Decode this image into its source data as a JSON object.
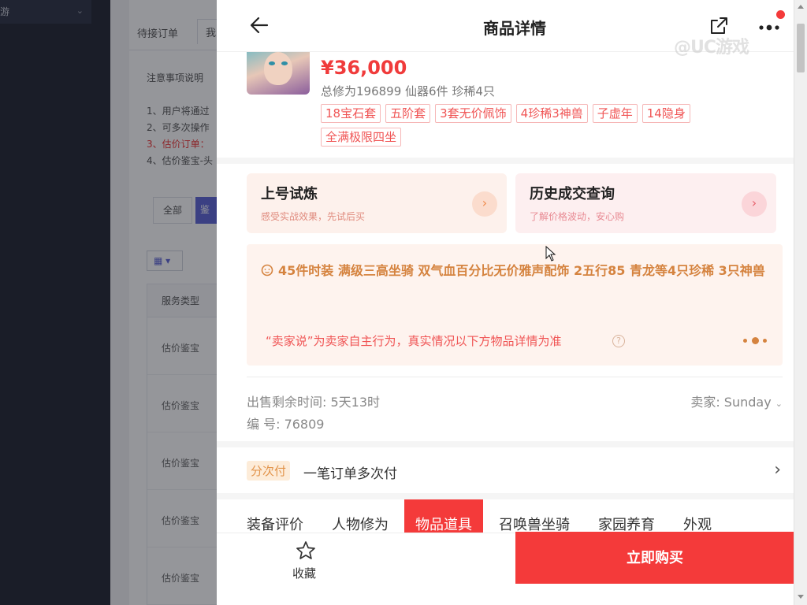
{
  "background_app": {
    "sidebar_menu_label": "游",
    "tabs": [
      "待接订单",
      "我"
    ],
    "notice_title": "注意事项说明",
    "notice_lines": [
      "1、用户将通过",
      "2、可多次操作",
      "3、估价订单：",
      "4、估价鉴宝-头"
    ],
    "filter_all": "全部",
    "filter_active": "鉴",
    "grid_button": "▦ ▾",
    "table_header": "服务类型",
    "table_rows": [
      "估价鉴宝",
      "估价鉴宝",
      "估价鉴宝",
      "估价鉴宝",
      "估价鉴宝"
    ]
  },
  "topbar": {
    "title": "商品详情",
    "watermark": "@UC游戏"
  },
  "product": {
    "price": "¥36,000",
    "stats": "总修为196899  仙器6件  珍稀4只",
    "tags": [
      "18宝石套",
      "五阶套",
      "3套无价佩饰",
      "4珍稀3神兽",
      "子虚年",
      "14隐身",
      "全满极限四坐"
    ]
  },
  "promos": [
    {
      "title": "上号试炼",
      "subtitle": "感受实战效果，先试后买"
    },
    {
      "title": "历史成交查询",
      "subtitle": "了解价格波动，安心购"
    }
  ],
  "seller_says": {
    "text": "45件时装 满级三高坐骑 双气血百分比无价雅声配饰 2五行85 青龙等4只珍稀 3只神兽",
    "disclaimer": "“卖家说”为卖家自主行为，真实情况以下方物品详情为准",
    "help_icon": "?"
  },
  "meta": {
    "remaining_time": "出售剩余时间: 5天13时",
    "serial": "编  号: 76809",
    "seller": "卖家: Sunday"
  },
  "installment": {
    "badge": "分次付",
    "text": "一笔订单多次付"
  },
  "detail_tabs": [
    "装备评价",
    "人物修为",
    "物品道具",
    "召唤兽坐骑",
    "家园养育",
    "外观"
  ],
  "active_tab_index": 2,
  "bottom": {
    "favorite_label": "收藏",
    "buy_label": "立即购买"
  },
  "colors": {
    "accent_red": "#f43a3a",
    "seller_orange": "#d5833f",
    "tag_red": "#f05555"
  }
}
